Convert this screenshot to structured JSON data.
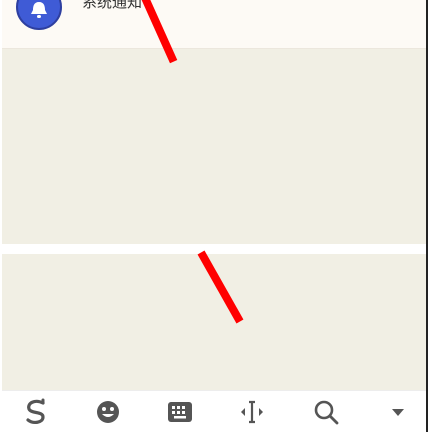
{
  "header": {
    "title": "系统通知",
    "avatar_icon": "bell-icon",
    "avatar_color": "#3f5bd6"
  },
  "toolbar": {
    "items": [
      {
        "name": "sogou-logo-icon"
      },
      {
        "name": "emoji-icon"
      },
      {
        "name": "keyboard-icon"
      },
      {
        "name": "cursor-move-icon"
      },
      {
        "name": "search-icon"
      },
      {
        "name": "collapse-keyboard-icon"
      }
    ]
  },
  "colors": {
    "panel_bg": "#f1efe4",
    "header_bg": "#fdfaf5",
    "annotation_red": "#ff0000"
  }
}
